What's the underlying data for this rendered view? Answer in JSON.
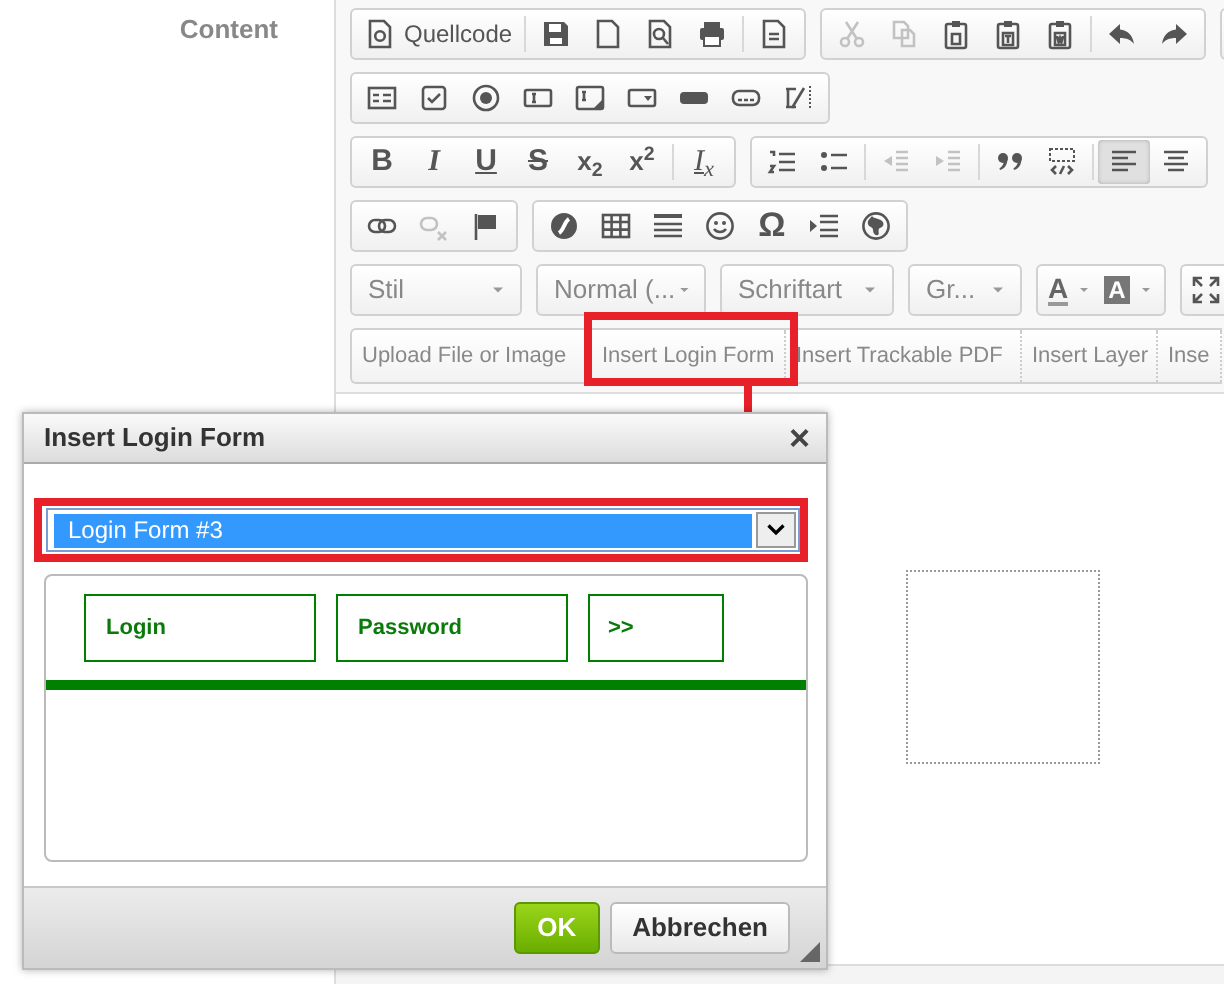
{
  "field_label": "Content",
  "toolbar_rows": [
    [
      [
        {
          "label": "Quellcode",
          "disabled": false
        },
        {
          "disabled": false
        },
        {
          "disabled": false
        },
        {
          "disabled": false
        },
        {
          "disabled": false
        },
        {
          "disabled": false
        }
      ],
      [
        {
          "disabled": true
        },
        {
          "disabled": true
        },
        {
          "disabled": false
        },
        {
          "disabled": false
        },
        {
          "disabled": false
        },
        {
          "disabled": false
        },
        {
          "disabled": false
        }
      ]
    ],
    [
      [
        {
          "disabled": false
        },
        {
          "disabled": false
        },
        {
          "disabled": false
        },
        {
          "disabled": false
        },
        {
          "disabled": false
        },
        {
          "disabled": false
        },
        {
          "disabled": false
        },
        {
          "disabled": false
        },
        {
          "disabled": false
        }
      ]
    ],
    [
      [
        {
          "label": "B",
          "disabled": false
        },
        {
          "label": "I",
          "disabled": false
        },
        {
          "label": "U",
          "disabled": false
        },
        {
          "label": "S",
          "disabled": false
        },
        {
          "label": "x$_{2}$",
          "disabled": false
        },
        {
          "label": "x$^{2}$",
          "disabled": false
        },
        {
          "label": "I$_{x}$",
          "disabled": false
        }
      ],
      [
        {
          "disabled": false
        },
        {
          "disabled": false
        },
        {
          "disabled": true
        },
        {
          "disabled": true
        },
        {
          "disabled": false
        },
        {
          "disabled": false
        },
        {
          "disabled": false,
          "selected": true
        },
        {
          "disabled": false,
          "selected": false
        }
      ]
    ],
    [
      [
        {
          "disabled": false
        },
        {
          "disabled": true
        },
        {
          "disabled": false
        }
      ],
      [
        {
          "disabled": false
        },
        {
          "disabled": false
        },
        {
          "disabled": false
        },
        {
          "disabled": false
        },
        {
          "label": "Ω",
          "disabled": false
        },
        {
          "disabled": false
        },
        {
          "disabled": false
        }
      ]
    ]
  ],
  "format_combos": [
    {
      "label": "Stil"
    },
    {
      "label": "Normal (..."
    },
    {
      "label": "Schriftart"
    },
    {
      "label": "Gr..."
    }
  ],
  "color_buttons": [
    {
      "label": "A"
    },
    {
      "label": "A"
    }
  ],
  "plugin_buttons": [
    {
      "label": "Upload File or Image"
    },
    {
      "label": "Insert Login Form"
    },
    {
      "label": "Insert Trackable PDF"
    },
    {
      "label": "Insert Layer"
    },
    {
      "label": "Inse"
    }
  ],
  "dialog": {
    "title": "Insert Login Form",
    "close": "×",
    "select": {
      "value": "Login Form #3"
    },
    "preview": {
      "login_field": {
        "placeholder": "Login"
      },
      "password_field": {
        "placeholder": "Password"
      },
      "submit": ">>"
    },
    "buttons": [
      {
        "label": "OK",
        "kind": "primary"
      },
      {
        "label": "Abbrechen",
        "kind": "secondary"
      }
    ]
  }
}
